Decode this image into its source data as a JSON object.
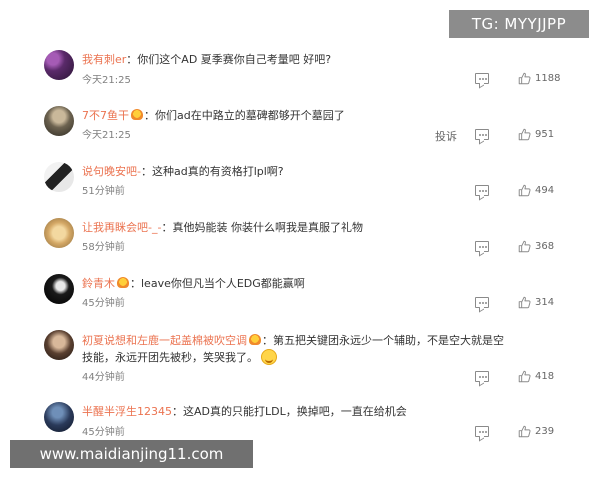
{
  "watermark_top": "TG: MYYJJPP",
  "watermark_bottom": "www.maidianjing11.com",
  "report_label": "投诉",
  "comments": [
    {
      "username": "我有刺er",
      "colon": "：",
      "text": "你们这个AD 夏季赛你自己考量吧 好吧?",
      "time": "今天21:25",
      "likes": "1188"
    },
    {
      "username": "7不7鱼干",
      "colon": "：",
      "text": "你们ad在中路立的墓碑都够开个墓园了",
      "time": "今天21:25",
      "likes": "951"
    },
    {
      "username": "说句晚安吧-",
      "colon": "：",
      "text": "这种ad真的有资格打lpl啊?",
      "time": "51分钟前",
      "likes": "494"
    },
    {
      "username": "让我再眯会吧-_-",
      "colon": "：",
      "text": "真他妈能装 你装什么啊我是真服了礼物",
      "time": "58分钟前",
      "likes": "368"
    },
    {
      "username": "鈴青木",
      "colon": "：",
      "text": "leave你但凡当个人EDG都能赢啊",
      "time": "45分钟前",
      "likes": "314"
    },
    {
      "username": "初夏说想和左鹿一起盖棉被吹空调",
      "colon": "：",
      "text": "第五把关键团永远少一个辅助，不是空大就是空技能，永远开团先被秒，笑哭我了。",
      "time": "44分钟前",
      "likes": "418"
    },
    {
      "username": "半醒半浮生12345",
      "colon": "：",
      "text": "这AD真的只能打LDL，换掉吧，一直在给机会",
      "time": "45分钟前",
      "likes": "239"
    }
  ],
  "icons": {
    "reply": "comment-icon",
    "like": "thumbs-up-icon",
    "medal": "fan-medal-icon",
    "emoji": "laugh-cry-emoji-icon"
  },
  "colors": {
    "username": "#eb7350",
    "text": "#333333",
    "meta": "#808080"
  }
}
